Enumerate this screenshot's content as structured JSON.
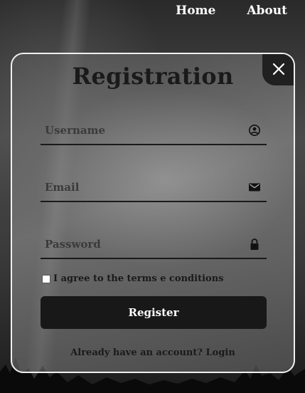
{
  "nav": {
    "items": [
      {
        "label": "Home"
      },
      {
        "label": "About"
      }
    ]
  },
  "form": {
    "title": "Registration",
    "username": {
      "placeholder": "Username",
      "value": "",
      "icon": "user-circle-icon"
    },
    "email": {
      "placeholder": "Email",
      "value": "",
      "icon": "mail-icon"
    },
    "password": {
      "placeholder": "Password",
      "value": "",
      "icon": "lock-icon"
    },
    "agree_label": "I agree to the terms e conditions",
    "agree_checked": false,
    "submit_label": "Register",
    "login_prompt": "Already have an account?",
    "login_link": "Login"
  },
  "colors": {
    "panel_border": "#f0f0f0",
    "button_bg": "#181818",
    "text_dark": "#1a1a1a",
    "nav_text": "#ffffff"
  }
}
